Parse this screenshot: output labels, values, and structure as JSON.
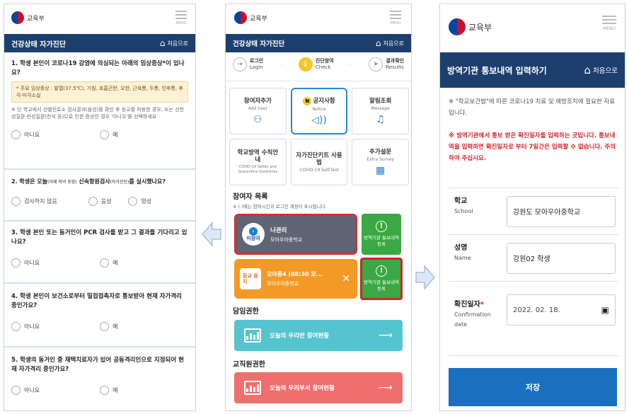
{
  "common": {
    "ministry": "교육부",
    "menu": "MENU",
    "home": "처음으로"
  },
  "left": {
    "title": "건강상태 자가진단",
    "q1": {
      "text": "1. 학생 본인이 코로나19 감염에 의심되는 아래의 임상증상*이 있나요?",
      "box": "* 주요 임상증상 : 발열(37.5℃), 기침, 호흡곤란, 오한, 근육통, 두통, 인후통, 후각·미각소실",
      "note": "※ 단 학교에서 선별진료소 검사결과(음성)를 확인 후 등교를 허용한 경우, 또는 선천성질환·만성질환(천식 등)으로 인한 증상인 경우 '아니오'를 선택하세요",
      "options": [
        "아니요",
        "예"
      ]
    },
    "q2": {
      "prefix": "2. 학생은 오늘",
      "small1": "(어제 저녁 포함)",
      "mid": " 신속항원검사",
      "small2": "(자가진단)",
      "suffix": "를 실시했나요?",
      "options": [
        "검사하지 않음",
        "음성",
        "양성"
      ]
    },
    "q3": {
      "text": "3. 학생 본인 또는 동거인이 PCR 검사를 받고 그 결과를 기다리고 있나요?",
      "options": [
        "아니요",
        "예"
      ]
    },
    "q4": {
      "text": "4. 학생 본인이 보건소로부터 밀접접촉자로 통보받아 현재 자가격리 중인가요?",
      "options": [
        "아니요",
        "예"
      ]
    },
    "q5": {
      "text": "5. 학생의 동거인 중 재택치료자가 있어 공동격리인으로 지정되어 현재 자가격리 중인가요?",
      "options": [
        "아니요",
        "예"
      ]
    }
  },
  "middle": {
    "title": "건강상태 자가진단",
    "steps": [
      {
        "ko": "로그인",
        "en": "Login"
      },
      {
        "ko": "진단참여",
        "en": "Check"
      },
      {
        "ko": "결과확인",
        "en": "Results"
      }
    ],
    "cards": [
      {
        "ko": "참여자추가",
        "en": "Add User",
        "icon": "add-user-icon",
        "glyph": "👤"
      },
      {
        "ko": "공지사항",
        "en": "Notice",
        "icon": "megaphone-icon",
        "glyph": "📢",
        "badge": "N"
      },
      {
        "ko": "알림조회",
        "en": "Message",
        "icon": "bell-icon",
        "glyph": "🔔"
      },
      {
        "ko": "학교방역 수칙안내",
        "en": "COVID-19 Safety and Quarantine Guidelines",
        "icon": "",
        "glyph": ""
      },
      {
        "ko": "자가진단키트 사용법",
        "en": "COVID-19 Self-Test",
        "icon": "",
        "glyph": ""
      },
      {
        "ko": "추가설문",
        "en": "Extra Survey",
        "icon": "calendar-icon",
        "glyph": "📅"
      }
    ],
    "participants_title": "참여자 목록",
    "participants_note": "※ ( )에는 참여시간과 로그인 계정이 표시됩니다.",
    "user1": {
      "status": "미참여",
      "name": "나관리",
      "school": "모아우아중학교",
      "register": "방역기관 통보내역 등록"
    },
    "user2": {
      "status": "등교 중지",
      "name": "모아중4 (08:30 모...",
      "school": "모아우아중학교",
      "register": "방역기관 통보내역 등록"
    },
    "homeroom_title": "담임권한",
    "homeroom_banner": "오늘의 우리반 참여현황",
    "staff_title": "교직원권한",
    "staff_banner": "오늘의 우리부서 참여현황"
  },
  "right": {
    "title": "방역기관 통보내역 입력하기",
    "info1": "※ \"학교보건법\"에 따른 코로나19 치료 및 예방조치에 필요한 자료입니다.",
    "info2": "※ 방역기관에서 통보 받은 확진일자를 입력하는 곳입니다. 통보내역을 입력하면 확진일자로 부터 7일간은 입력할 수 없습니다. 주의하여 주십시요.",
    "school_label": "학교",
    "school_en": "School",
    "school_value": "강원도  모아우아중학교",
    "name_label": "성명",
    "name_en": "Name",
    "name_value": "강원02  학생",
    "date_label": "확진일자",
    "date_en": "Confirmation date",
    "date_value": "2022. 02. 18.",
    "save": "저장"
  },
  "colors": {
    "navy": "#1d3f6e",
    "orange": "#f39a26",
    "green": "#3aa843",
    "teal": "#55c4cf",
    "coral": "#ef6e6e",
    "blue": "#1b6fc0"
  }
}
